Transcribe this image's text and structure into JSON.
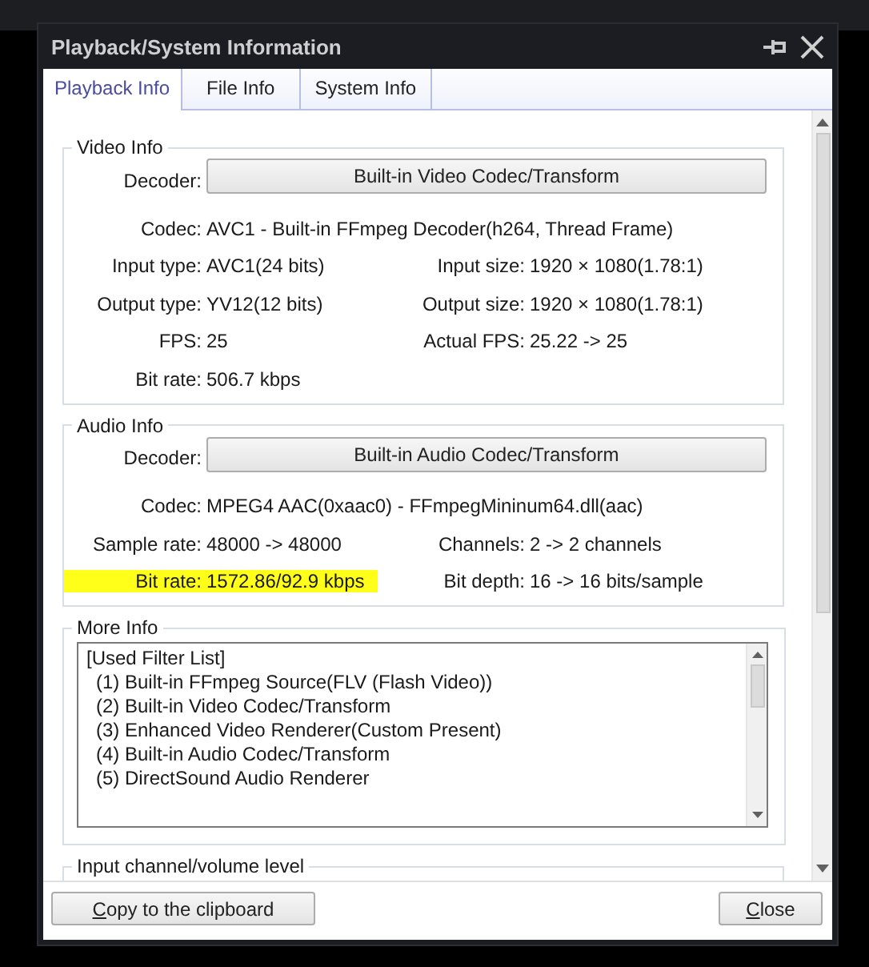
{
  "window": {
    "title": "Playback/System Information"
  },
  "tabs": [
    {
      "label": "Playback Info",
      "selected": true
    },
    {
      "label": "File Info",
      "selected": false
    },
    {
      "label": "System Info",
      "selected": false
    }
  ],
  "video_info": {
    "title": "Video Info",
    "decoder_label": "Decoder:",
    "decoder_button": "Built-in Video Codec/Transform",
    "rows": [
      {
        "kind": "wide",
        "left": {
          "label": "Codec:",
          "value": "AVC1 - Built-in FFmpeg Decoder(h264, Thread Frame)",
          "highlighted": false
        }
      },
      {
        "kind": "pair",
        "left": {
          "label": "Input type:",
          "value": "AVC1(24 bits)",
          "highlighted": false
        },
        "right": {
          "label": "Input size:",
          "value": "1920 × 1080(1.78:1)",
          "highlighted": false
        }
      },
      {
        "kind": "pair",
        "left": {
          "label": "Output type:",
          "value": "YV12(12 bits)",
          "highlighted": false
        },
        "right": {
          "label": "Output size:",
          "value": "1920 × 1080(1.78:1)",
          "highlighted": false
        }
      },
      {
        "kind": "pair",
        "left": {
          "label": "FPS:",
          "value": "25",
          "highlighted": false
        },
        "right": {
          "label": "Actual FPS:",
          "value": "25.22 -> 25",
          "highlighted": false
        }
      },
      {
        "kind": "pair",
        "left": {
          "label": "Bit rate:",
          "value": "506.7 kbps",
          "highlighted": false
        }
      }
    ]
  },
  "audio_info": {
    "title": "Audio Info",
    "decoder_label": "Decoder:",
    "decoder_button": "Built-in Audio Codec/Transform",
    "rows": [
      {
        "kind": "wide",
        "left": {
          "label": "Codec:",
          "value": "MPEG4 AAC(0xaac0) - FFmpegMininum64.dll(aac)",
          "highlighted": false
        }
      },
      {
        "kind": "pair",
        "left": {
          "label": "Sample rate:",
          "value": "48000 -> 48000",
          "highlighted": false
        },
        "right": {
          "label": "Channels:",
          "value": "2 -> 2 channels",
          "highlighted": false
        }
      },
      {
        "kind": "pair",
        "left": {
          "label": "Bit rate:",
          "value": "1572.86/92.9 kbps",
          "highlighted": true
        },
        "right": {
          "label": "Bit depth:",
          "value": "16 -> 16 bits/sample",
          "highlighted": false
        }
      }
    ]
  },
  "more_info": {
    "title": "More Info",
    "heading": "[Used Filter List]",
    "items": [
      "(1) Built-in FFmpeg Source(FLV (Flash Video))",
      "(2) Built-in Video Codec/Transform",
      "(3) Enhanced Video Renderer(Custom Present)",
      "(4) Built-in Audio Codec/Transform",
      "(5) DirectSound Audio Renderer"
    ]
  },
  "input_channel": {
    "title": "Input channel/volume level"
  },
  "buttons": [
    "Copy to the clipboard",
    "Close"
  ]
}
